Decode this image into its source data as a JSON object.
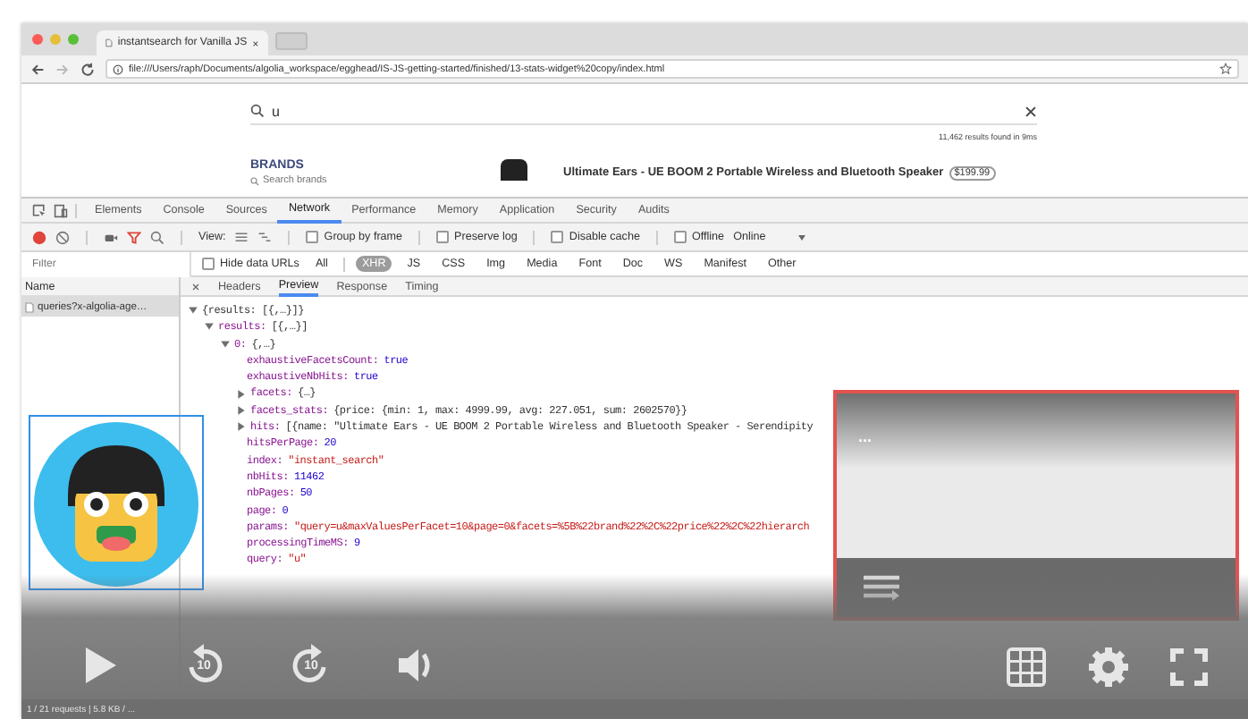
{
  "browser": {
    "tab": {
      "title": "instantsearch for Vanilla JS"
    },
    "address": {
      "url": "file:///Users/raph/Documents/algolia_workspace/egghead/IS-JS-getting-started/finished/13-stats-widget%20copy/index.html"
    }
  },
  "page": {
    "search": {
      "value": "u"
    },
    "stats": "11,462 results found in 9ms",
    "brands": {
      "heading": "BRANDS",
      "search": {
        "placeholder": "Search brands"
      }
    },
    "product": {
      "title": "Ultimate Ears - UE BOOM 2 Portable Wireless and Bluetooth Speaker",
      "price": "$199.99"
    }
  },
  "devtools": {
    "tabs": [
      {
        "label": "Elements",
        "selected": false
      },
      {
        "label": "Console",
        "selected": false
      },
      {
        "label": "Sources",
        "selected": false
      },
      {
        "label": "Network",
        "selected": true
      },
      {
        "label": "Performance",
        "selected": false
      },
      {
        "label": "Memory",
        "selected": false
      },
      {
        "label": "Application",
        "selected": false
      },
      {
        "label": "Security",
        "selected": false
      },
      {
        "label": "Audits",
        "selected": false
      }
    ],
    "toolbar": {
      "recording": true,
      "filter_active": true,
      "view_label": "View:",
      "checkboxes": [
        {
          "label": "Group by frame",
          "checked": false
        },
        {
          "label": "Preserve log",
          "checked": false
        },
        {
          "label": "Disable cache",
          "checked": false
        },
        {
          "label": "Offline",
          "checked": false
        }
      ],
      "throttle": "Online"
    },
    "filter": {
      "placeholder": "Filter",
      "hide_data_urls": {
        "label": "Hide data URLs",
        "checked": false
      },
      "types": [
        {
          "label": "All",
          "selected": false
        },
        {
          "label": "XHR",
          "selected": true
        },
        {
          "label": "JS",
          "selected": false
        },
        {
          "label": "CSS",
          "selected": false
        },
        {
          "label": "Img",
          "selected": false
        },
        {
          "label": "Media",
          "selected": false
        },
        {
          "label": "Font",
          "selected": false
        },
        {
          "label": "Doc",
          "selected": false
        },
        {
          "label": "WS",
          "selected": false
        },
        {
          "label": "Manifest",
          "selected": false
        },
        {
          "label": "Other",
          "selected": false
        }
      ]
    },
    "requests": {
      "column": "Name",
      "rows": [
        {
          "name": "queries?x-algolia-age…",
          "selected": true
        }
      ]
    },
    "detail": {
      "tabs": [
        {
          "label": "Headers",
          "selected": false
        },
        {
          "label": "Preview",
          "selected": true
        },
        {
          "label": "Response",
          "selected": false
        },
        {
          "label": "Timing",
          "selected": false
        }
      ],
      "tree": [
        {
          "value": "{results: [{,…}]}",
          "kind": "object",
          "expanded": true,
          "children": [
            {
              "key": "results:",
              "value": "[{,…}]",
              "kind": "object",
              "expanded": true,
              "children": [
                {
                  "key": "0:",
                  "value": "{,…}",
                  "kind": "object",
                  "expanded": true,
                  "children": [
                    {
                      "key": "exhaustiveFacetsCount:",
                      "value": "true",
                      "kind": "bool"
                    },
                    {
                      "key": "exhaustiveNbHits:",
                      "value": "true",
                      "kind": "bool"
                    },
                    {
                      "key": "facets:",
                      "value": "{…}",
                      "kind": "object",
                      "expanded": false
                    },
                    {
                      "key": "facets_stats:",
                      "value": "{price: {min: 1, max: 4999.99, avg: 227.051, sum: 2602570}}",
                      "kind": "object",
                      "expanded": false
                    },
                    {
                      "key": "hits:",
                      "value": "[{name: \"Ultimate Ears - UE BOOM 2 Portable Wireless and Bluetooth Speaker - Serendipity",
                      "kind": "object",
                      "expanded": false
                    },
                    {
                      "key": "hitsPerPage:",
                      "value": "20",
                      "kind": "number"
                    },
                    {
                      "key": "index:",
                      "value": "\"instant_search\"",
                      "kind": "string"
                    },
                    {
                      "key": "nbHits:",
                      "value": "11462",
                      "kind": "number"
                    },
                    {
                      "key": "nbPages:",
                      "value": "50",
                      "kind": "number"
                    },
                    {
                      "key": "page:",
                      "value": "0",
                      "kind": "number"
                    },
                    {
                      "key": "params:",
                      "value": "\"query=u&maxValuesPerFacet=10&page=0&facets=%5B%22brand%22%2C%22price%22%2C%22hierarch",
                      "kind": "string"
                    },
                    {
                      "key": "processingTimeMS:",
                      "value": "9",
                      "kind": "number"
                    },
                    {
                      "key": "query:",
                      "value": "\"u\"",
                      "kind": "string"
                    }
                  ]
                }
              ]
            }
          ]
        }
      ]
    },
    "status_bar": "1 / 21 requests | 5.8 KB / ..."
  },
  "player": {
    "mini_player": {
      "title": "..."
    },
    "controls": [
      {
        "kind": "play"
      },
      {
        "kind": "rewind",
        "label": "10"
      },
      {
        "kind": "forward",
        "label": "10"
      },
      {
        "kind": "volume"
      },
      {
        "kind": "grid"
      },
      {
        "kind": "settings"
      },
      {
        "kind": "fullscreen"
      }
    ]
  }
}
